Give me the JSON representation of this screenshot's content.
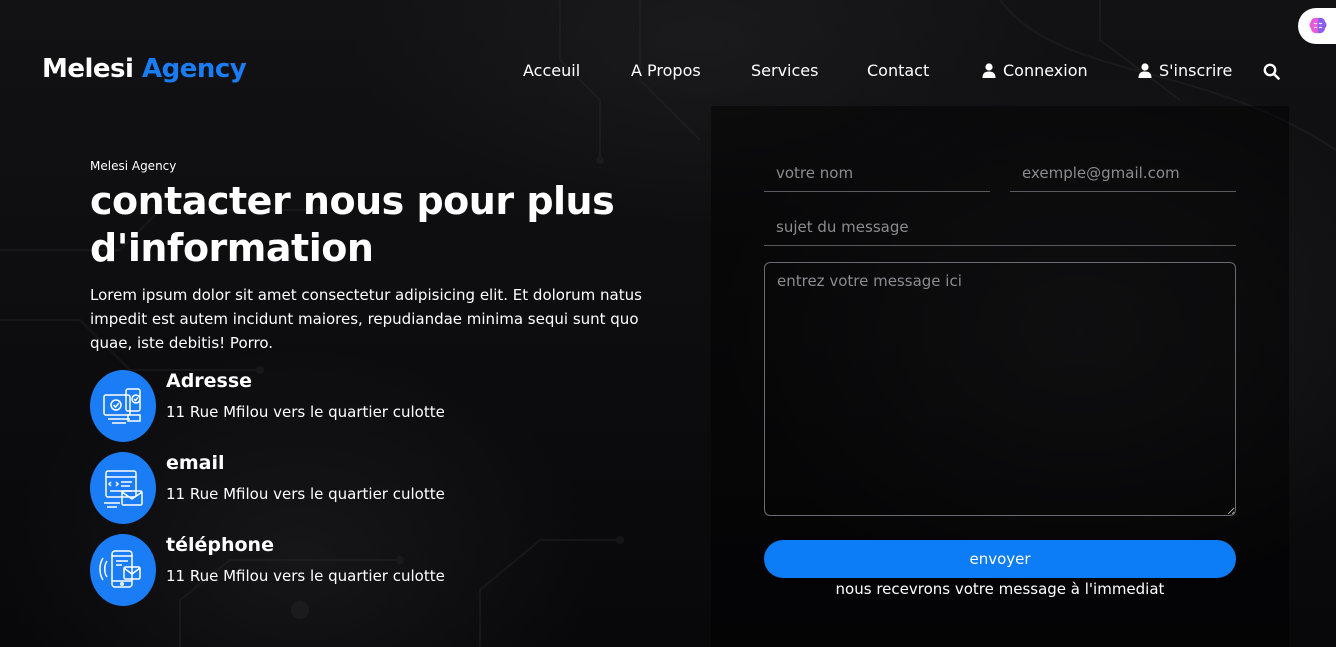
{
  "header": {
    "logo_primary": "Melesi",
    "logo_accent": "Agency",
    "nav": [
      {
        "label": "Acceuil"
      },
      {
        "label": "A Propos"
      },
      {
        "label": "Services"
      },
      {
        "label": "Contact"
      },
      {
        "label": "Connexion",
        "icon": "user-icon"
      },
      {
        "label": "S'inscrire",
        "icon": "user-icon"
      }
    ],
    "search_icon": "search-icon",
    "extension_icon": "brain-icon"
  },
  "intro": {
    "eyebrow": "Melesi Agency",
    "headline": "contacter nous pour plus d'information",
    "lead": "Lorem ipsum dolor sit amet consectetur adipisicing elit. Et dolorum natus impedit est autem incidunt maiores, repudiandae minima sequi sunt quo quae, iste debitis! Porro."
  },
  "contact_items": [
    {
      "icon": "address-icon",
      "title": "Adresse",
      "text": "11 Rue Mfilou vers le quartier culotte"
    },
    {
      "icon": "email-icon",
      "title": "email",
      "text": "11 Rue Mfilou vers le quartier culotte"
    },
    {
      "icon": "phone-icon",
      "title": "téléphone",
      "text": "11 Rue Mfilou vers le quartier culotte"
    }
  ],
  "form": {
    "name_placeholder": "votre nom",
    "email_placeholder": "exemple@gmail.com",
    "subject_placeholder": "sujet du message",
    "message_placeholder": "entrez votre message ici",
    "submit_label": "envoyer",
    "note": "nous recevrons votre message à l'immediat"
  },
  "colors": {
    "accent": "#1a7df5",
    "button": "#0d7cf7",
    "background": "#0b0b0c"
  }
}
